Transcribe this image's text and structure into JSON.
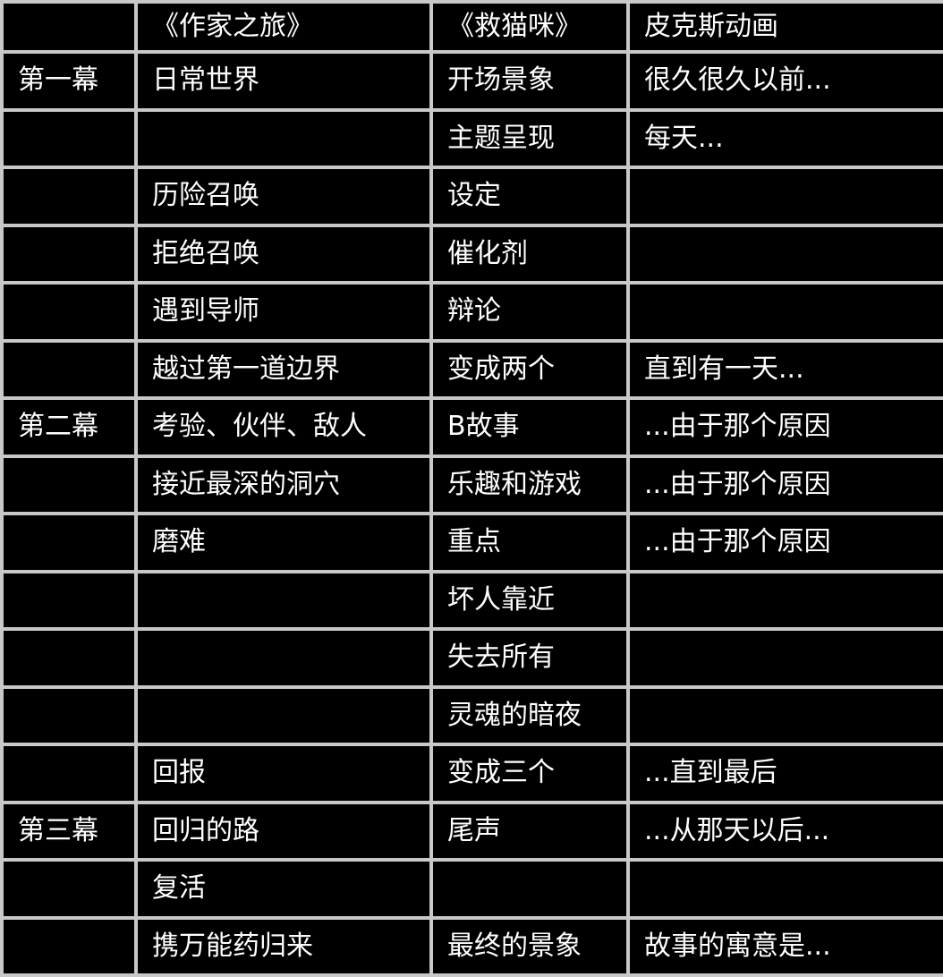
{
  "header": [
    "",
    "《作家之旅》",
    "《救猫咪》",
    "皮克斯动画"
  ],
  "rows": [
    [
      "第一幕",
      "日常世界",
      "开场景象",
      "很久很久以前..."
    ],
    [
      "",
      "",
      "主题呈现",
      "每天..."
    ],
    [
      "",
      "历险召唤",
      "设定",
      ""
    ],
    [
      "",
      "拒绝召唤",
      "催化剂",
      ""
    ],
    [
      "",
      "遇到导师",
      "辩论",
      ""
    ],
    [
      "",
      "越过第一道边界",
      "变成两个",
      "直到有一天..."
    ],
    [
      "第二幕",
      "考验、伙伴、敌人",
      "B故事",
      "...由于那个原因"
    ],
    [
      "",
      "接近最深的洞穴",
      "乐趣和游戏",
      "...由于那个原因"
    ],
    [
      "",
      "磨难",
      "重点",
      "...由于那个原因"
    ],
    [
      "",
      "",
      "坏人靠近",
      ""
    ],
    [
      "",
      "",
      "失去所有",
      ""
    ],
    [
      "",
      "",
      "灵魂的暗夜",
      ""
    ],
    [
      "",
      "回报",
      "变成三个",
      "...直到最后"
    ],
    [
      "第三幕",
      "回归的路",
      "尾声",
      "...从那天以后..."
    ],
    [
      "",
      "复活",
      "",
      ""
    ],
    [
      "",
      "携万能药归来",
      "最终的景象",
      "故事的寓意是..."
    ]
  ]
}
